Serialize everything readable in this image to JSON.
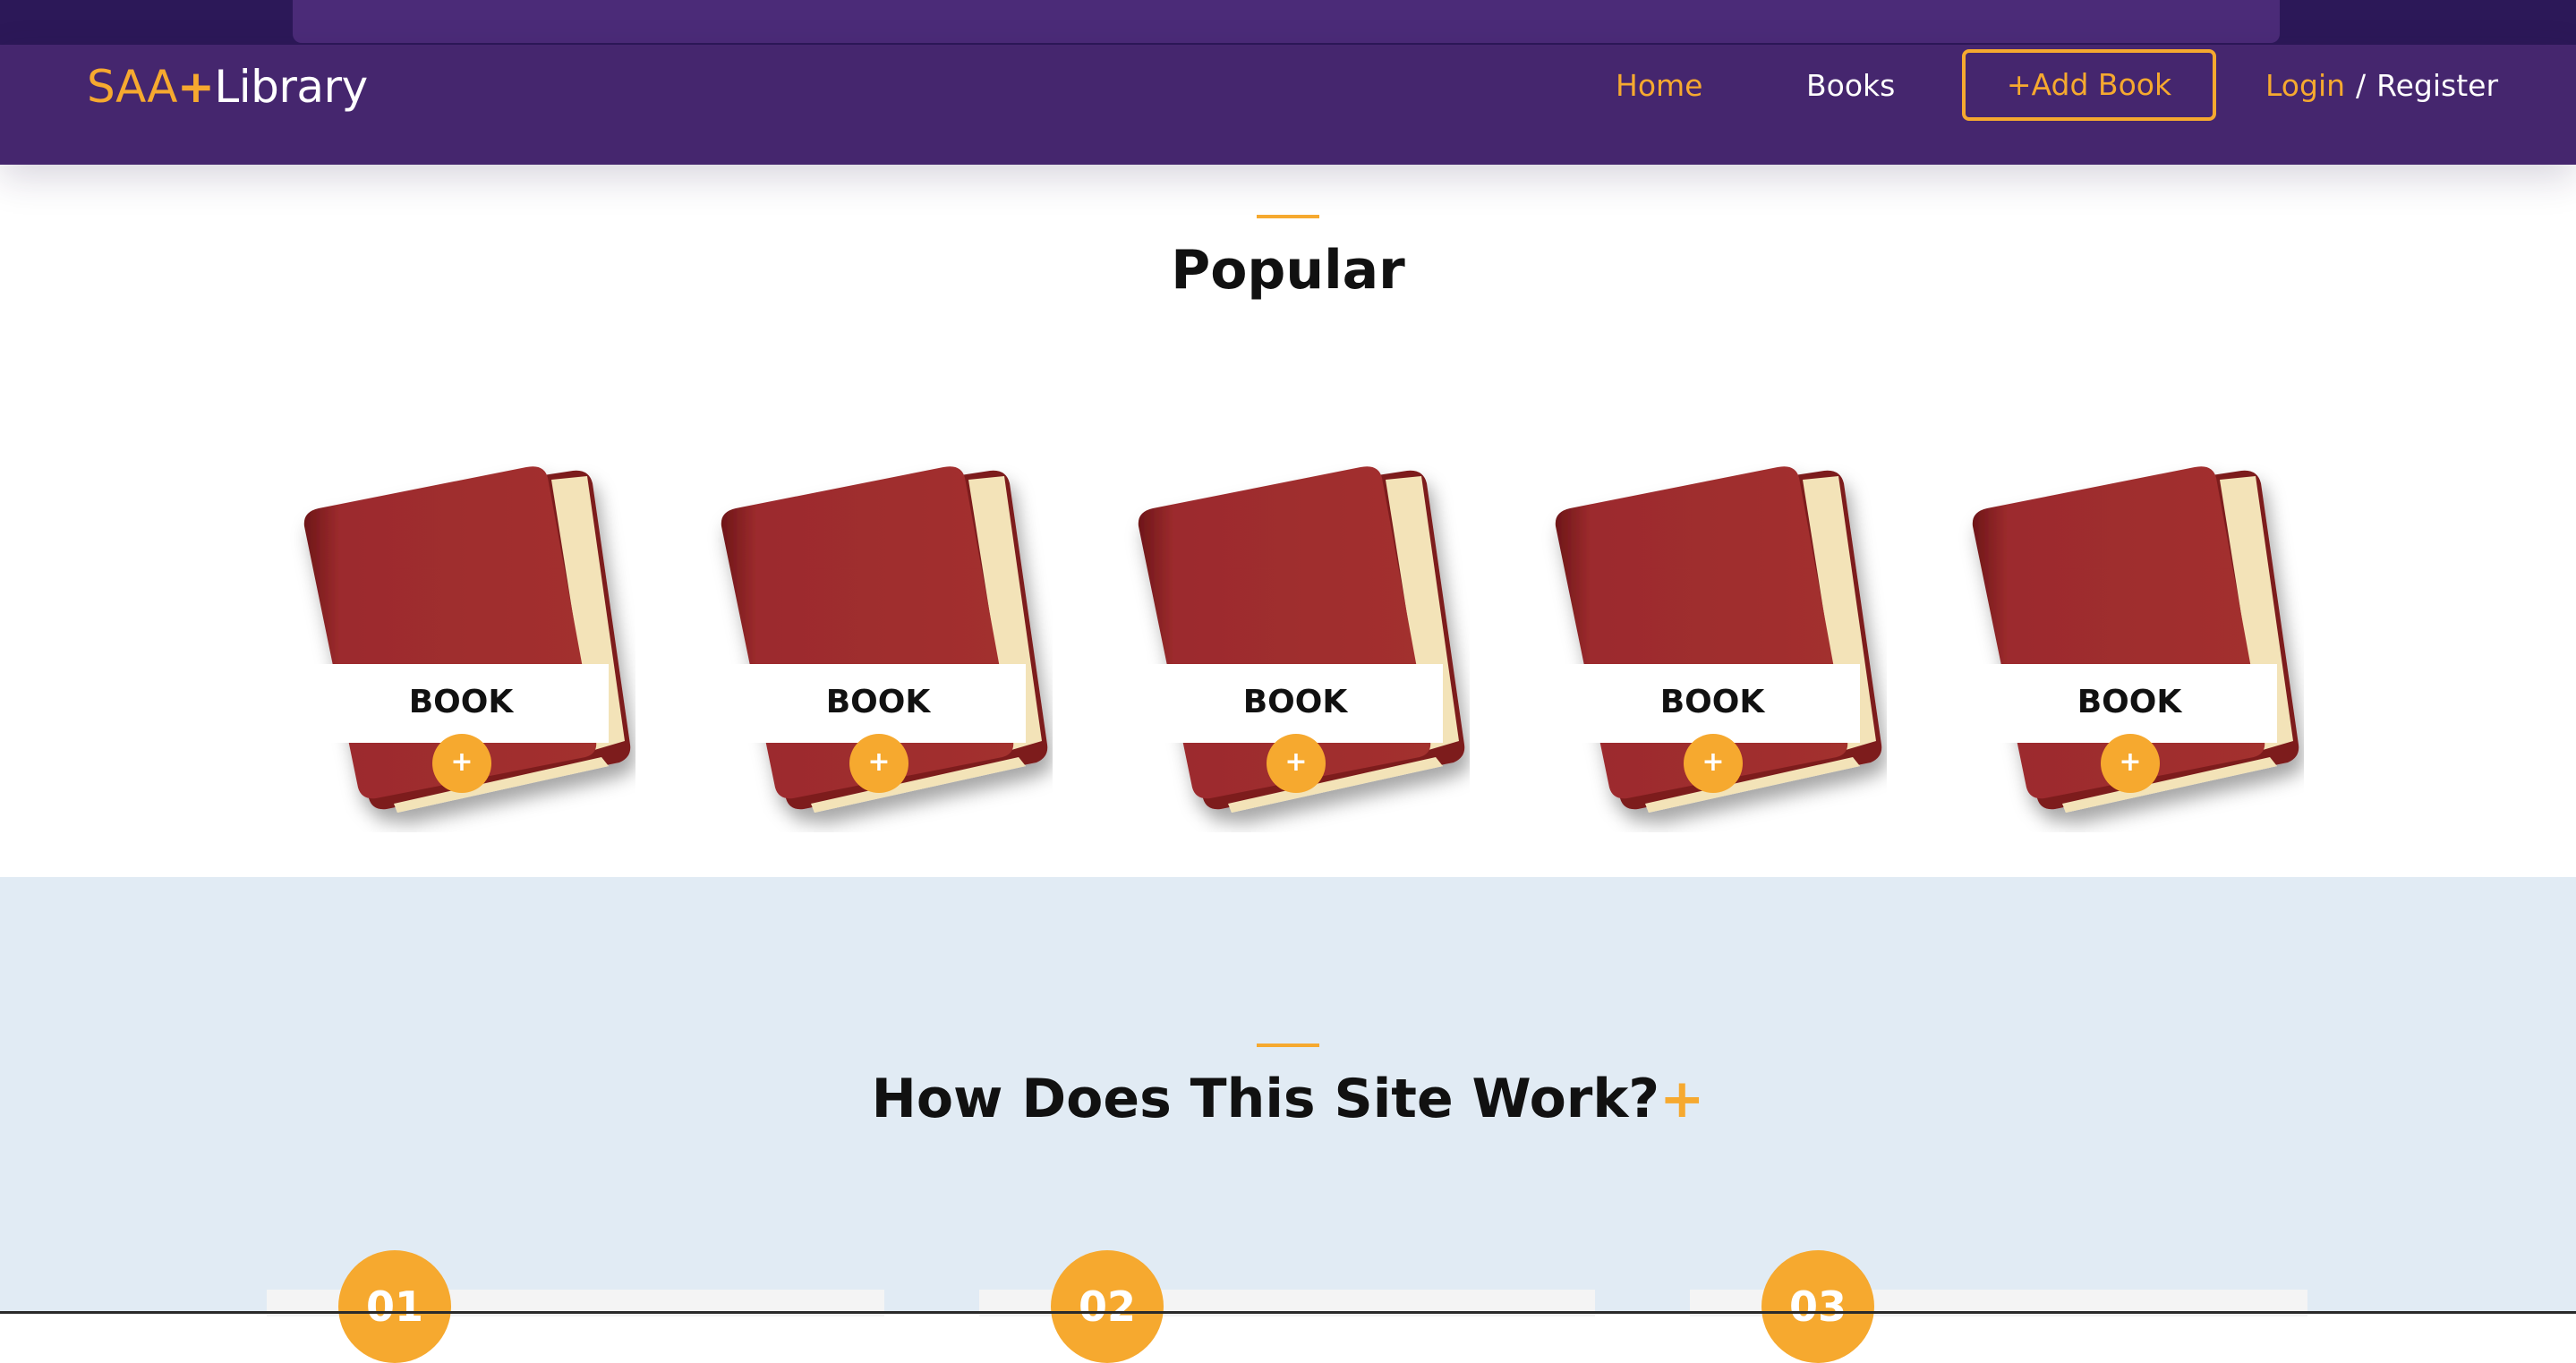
{
  "brand": {
    "part1": "SAA",
    "plus": "+",
    "part2": "Library"
  },
  "nav": {
    "home": "Home",
    "books": "Books",
    "add_book": "+Add Book",
    "login": "Login",
    "separator": "/",
    "register": "Register"
  },
  "popular": {
    "title": "Popular",
    "books": [
      {
        "label": "BOOK",
        "action": "+"
      },
      {
        "label": "BOOK",
        "action": "+"
      },
      {
        "label": "BOOK",
        "action": "+"
      },
      {
        "label": "BOOK",
        "action": "+"
      },
      {
        "label": "BOOK",
        "action": "+"
      }
    ]
  },
  "how": {
    "title": "How Does This Site Work?",
    "title_accent": "+",
    "steps": [
      {
        "number": "01"
      },
      {
        "number": "02"
      },
      {
        "number": "03"
      }
    ]
  },
  "colors": {
    "accent": "#f6a92f",
    "navbar": "#45266e",
    "how_background": "#e1ebf4",
    "book_cover": "#9c2b2d"
  },
  "icons": {
    "add_book_to_list": "plus-icon",
    "book_cover": "red-book-icon"
  }
}
